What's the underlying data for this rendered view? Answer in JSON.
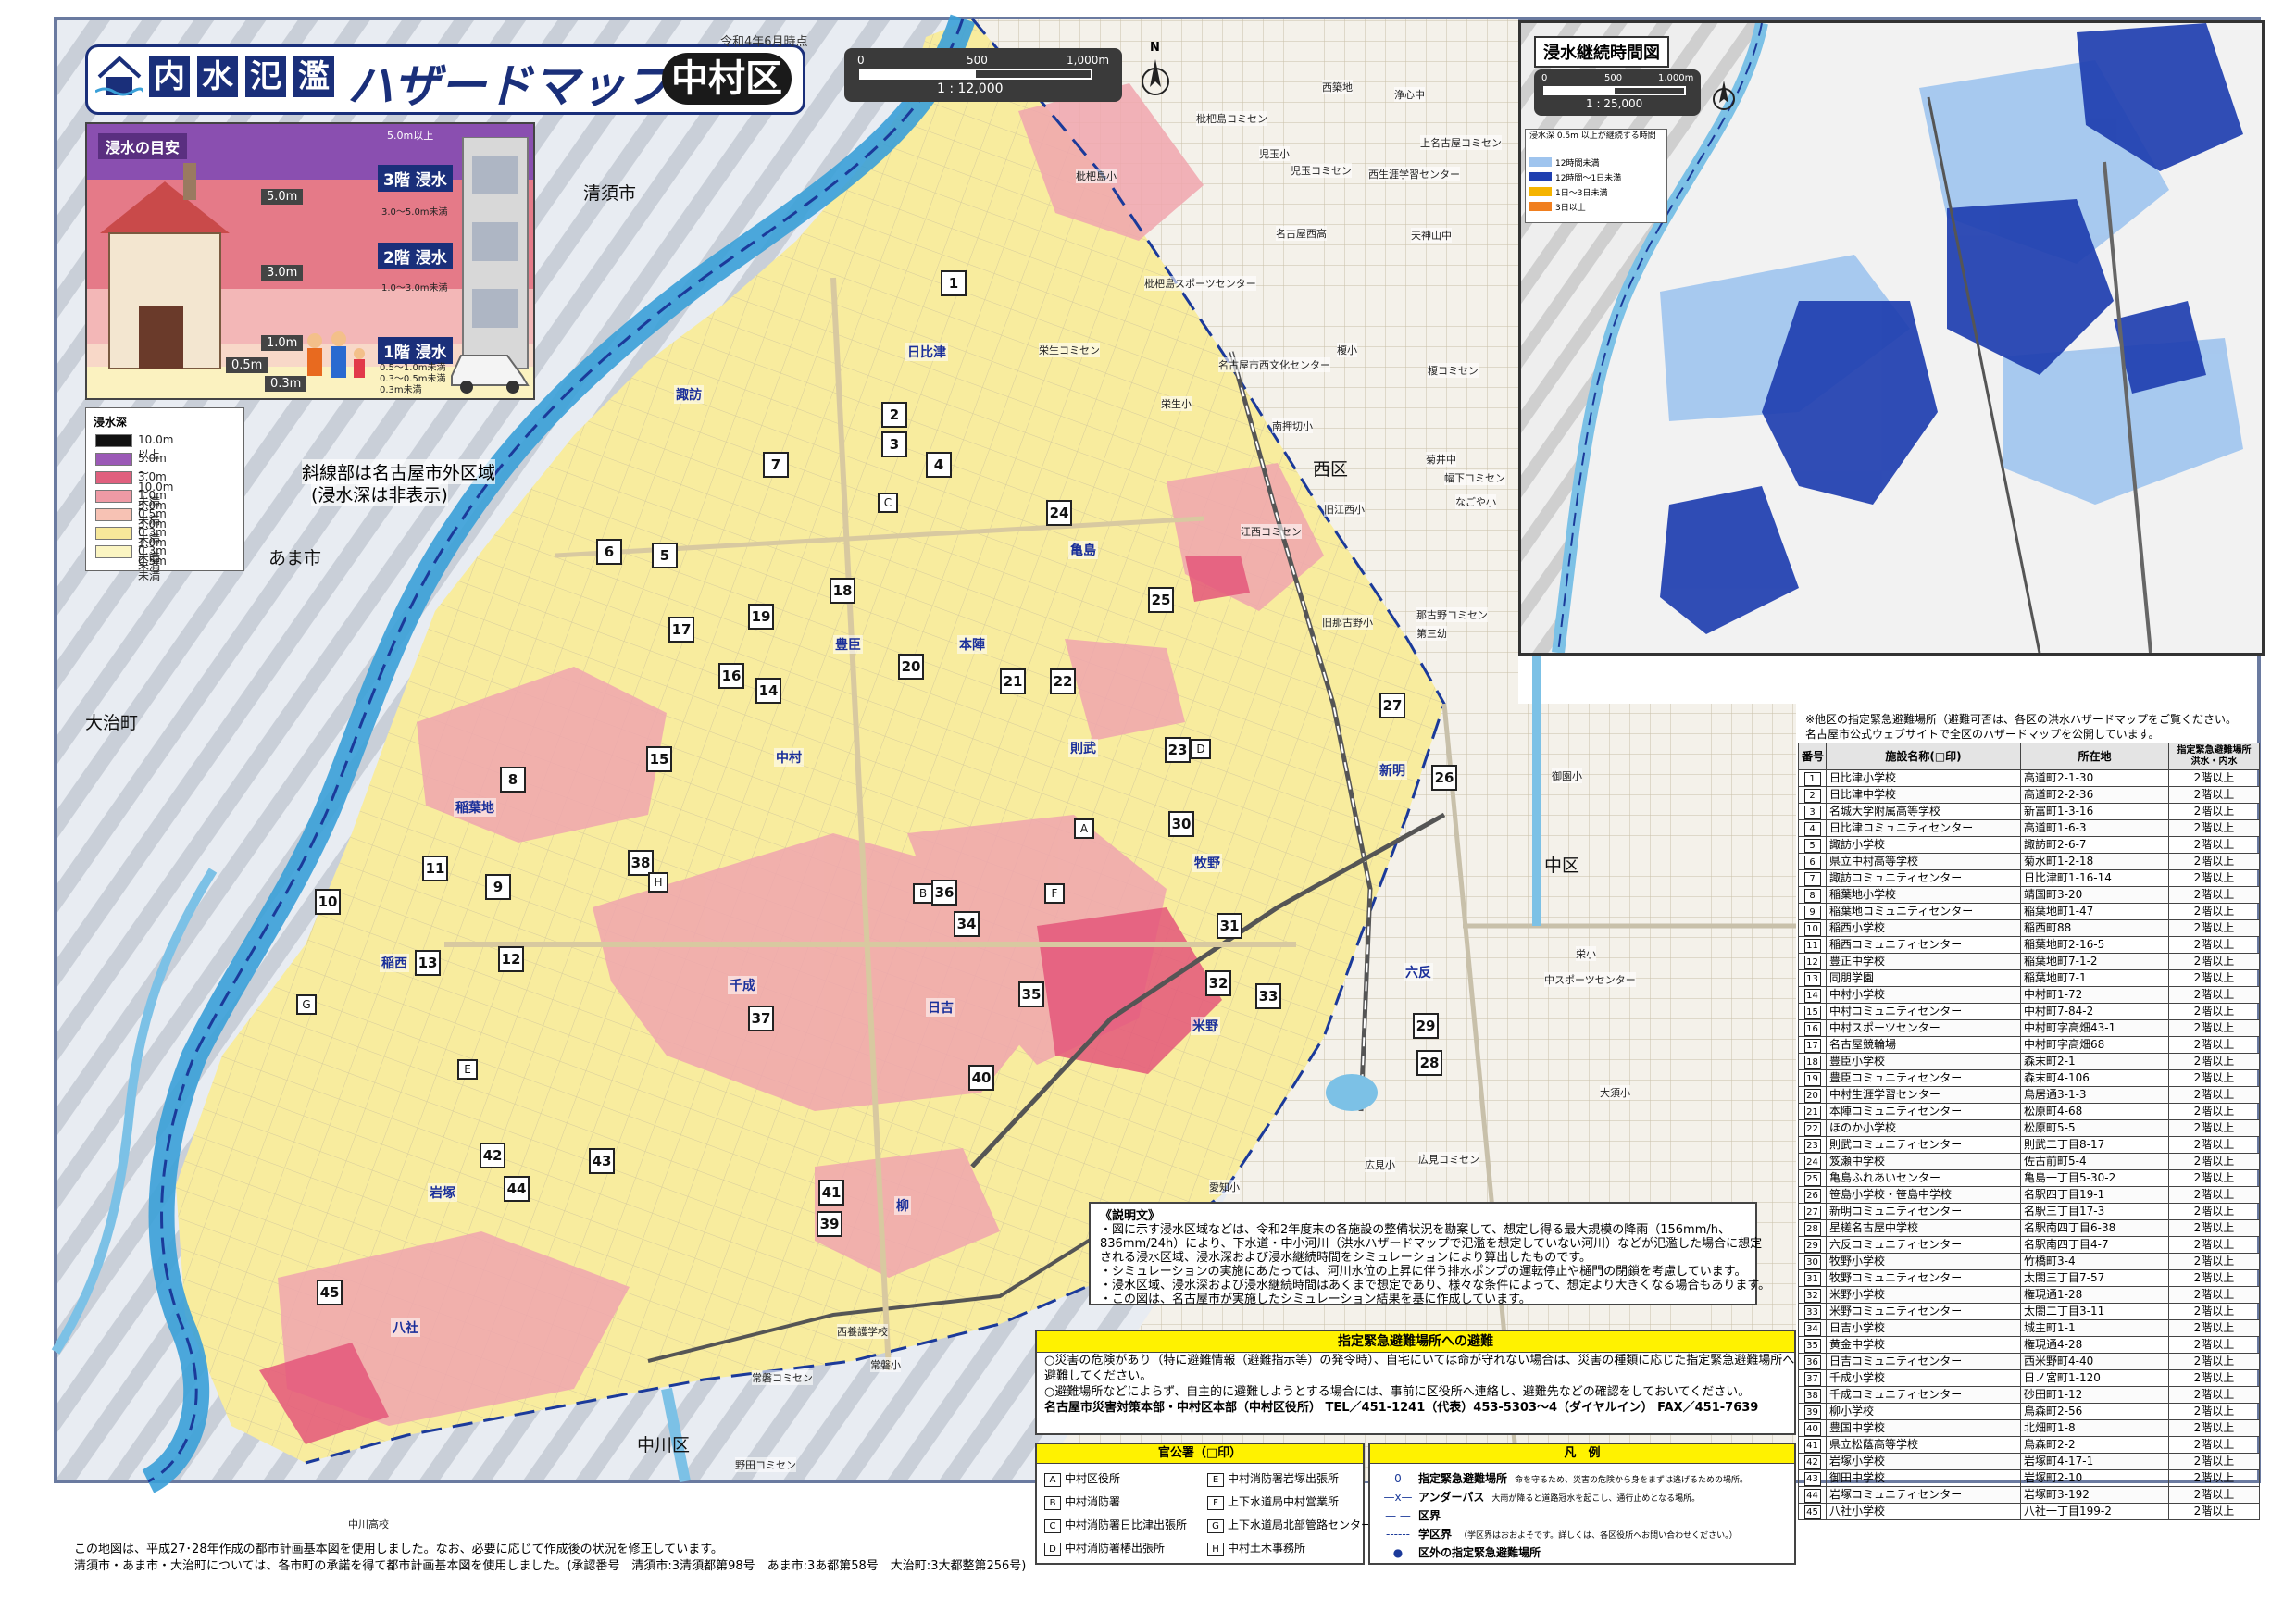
{
  "header": {
    "title_boxes": [
      "内",
      "水",
      "氾",
      "濫"
    ],
    "title_main": "ハザードマップ",
    "ward": "中村区",
    "date": "令和4年6月時点",
    "scale_ticks": [
      "0",
      "500",
      "1,000m"
    ],
    "scale_ratio": "1 : 12,000",
    "north": "N"
  },
  "depth_guide": {
    "title": "浸水の目安",
    "marks": [
      "5.0m",
      "3.0m",
      "1.0m",
      "0.5m",
      "0.3m"
    ],
    "top_label": "5.0m以上",
    "floors": [
      {
        "label": "3階 浸水",
        "range": "3.0～5.0m未満"
      },
      {
        "label": "2階 浸水",
        "range": "1.0～3.0m未満"
      },
      {
        "label": "1階 浸水",
        "range": "0.5～1.0m未満"
      }
    ],
    "low_ranges": [
      "0.3～0.5m未満",
      "0.3m未満"
    ]
  },
  "depth_legend": {
    "title": "浸水深",
    "items": [
      {
        "label": "10.0m以上",
        "color": "#111111"
      },
      {
        "label": "5.0m～10.0m未満",
        "color": "#9b59b6"
      },
      {
        "label": "3.0m～5.0m未満",
        "color": "#e0607e"
      },
      {
        "label": "1.0m～3.0m未満",
        "color": "#ef9aa5"
      },
      {
        "label": "0.5m～1.0m未満",
        "color": "#f7c2b4"
      },
      {
        "label": "0.3m～0.5m未満",
        "color": "#f7e89a"
      },
      {
        "label": "0.3m未満",
        "color": "#fbf5c2"
      }
    ]
  },
  "hatch_note": {
    "line1": "斜線部は名古屋市外区域",
    "line2": "(浸水深は非表示)"
  },
  "places": {
    "kiyosu": "清須市",
    "ama": "あま市",
    "oharu": "大治町",
    "nishi": "西区",
    "naka": "中区",
    "nakagawa": "中川区"
  },
  "districts": [
    "日比津",
    "諏訪",
    "亀島",
    "豊臣",
    "本陣",
    "中村",
    "則武",
    "新明",
    "稲葉地",
    "牧野",
    "稲西",
    "千成",
    "日吉",
    "米野",
    "六反",
    "岩塚",
    "柳",
    "八社"
  ],
  "facilities": [
    "枇杷島コミセン",
    "西築地",
    "浄心中",
    "児玉小",
    "児玉コミセン",
    "西生涯学習センター",
    "上名古屋コミセン",
    "枇杷島小",
    "名古屋西高",
    "天神山中",
    "枇杷島スポーツセンター",
    "栄生コミセン",
    "名古屋市西文化センター",
    "榎小",
    "榎コミセン",
    "栄生小",
    "南押切小",
    "菊井中",
    "幅下コミセン",
    "なごや小",
    "旧江西小",
    "江西コミセン",
    "那古野コミセン",
    "第三幼",
    "旧那古野小",
    "御園小",
    "栄小",
    "中スポーツセンター",
    "大須小",
    "愛知小",
    "広見小",
    "広見コミセン",
    "西養護学校",
    "常磐コミセン",
    "常磐小",
    "野田コミセン",
    "中川高校"
  ],
  "inset": {
    "title": "浸水継続時間図",
    "scale_ticks": [
      "0",
      "500",
      "1,000m"
    ],
    "scale_ratio": "1 : 25,000",
    "legend_title": "浸水深 0.5m 以上が継続する時間",
    "legend": [
      {
        "label": "12時間未満",
        "color": "#9fc4ee"
      },
      {
        "label": "12時間～1日未満",
        "color": "#1f3fb0"
      },
      {
        "label": "1日～3日未満",
        "color": "#f5b400"
      },
      {
        "label": "3日以上",
        "color": "#f07f1f"
      }
    ]
  },
  "shelter_note": {
    "line1": "※他区の指定緊急避難場所（避難可否は、各区の洪水ハザードマップをご覧ください。",
    "line2": "名古屋市公式ウェブサイトで全区のハザードマップを公開しています。"
  },
  "shelters": {
    "headers": [
      "番号",
      "施設名称(□印)",
      "所在地",
      "指定緊急避難場所 洪水・内水"
    ],
    "rows": [
      [
        "1",
        "日比津小学校",
        "高道町2-1-30",
        "2階以上"
      ],
      [
        "2",
        "日比津中学校",
        "高道町2-2-36",
        "2階以上"
      ],
      [
        "3",
        "名城大学附属高等学校",
        "新富町1-3-16",
        "2階以上"
      ],
      [
        "4",
        "日比津コミュニティセンター",
        "高道町1-6-3",
        "2階以上"
      ],
      [
        "5",
        "諏訪小学校",
        "諏訪町2-6-7",
        "2階以上"
      ],
      [
        "6",
        "県立中村高等学校",
        "菊水町1-2-18",
        "2階以上"
      ],
      [
        "7",
        "諏訪コミュニティセンター",
        "日比津町1-16-14",
        "2階以上"
      ],
      [
        "8",
        "稲葉地小学校",
        "靖国町3-20",
        "2階以上"
      ],
      [
        "9",
        "稲葉地コミュニティセンター",
        "稲葉地町1-47",
        "2階以上"
      ],
      [
        "10",
        "稲西小学校",
        "稲西町88",
        "2階以上"
      ],
      [
        "11",
        "稲西コミュニティセンター",
        "稲葉地町2-16-5",
        "2階以上"
      ],
      [
        "12",
        "豊正中学校",
        "稲葉地町7-1-2",
        "2階以上"
      ],
      [
        "13",
        "同朋学園",
        "稲葉地町7-1",
        "2階以上"
      ],
      [
        "14",
        "中村小学校",
        "中村町1-72",
        "2階以上"
      ],
      [
        "15",
        "中村コミュニティセンター",
        "中村町7-84-2",
        "2階以上"
      ],
      [
        "16",
        "中村スポーツセンター",
        "中村町字高畑43-1",
        "2階以上"
      ],
      [
        "17",
        "名古屋競輪場",
        "中村町字高畑68",
        "2階以上"
      ],
      [
        "18",
        "豊臣小学校",
        "森末町2-1",
        "2階以上"
      ],
      [
        "19",
        "豊臣コミュニティセンター",
        "森末町4-106",
        "2階以上"
      ],
      [
        "20",
        "中村生涯学習センター",
        "鳥居通3-1-3",
        "2階以上"
      ],
      [
        "21",
        "本陣コミュニティセンター",
        "松原町4-68",
        "2階以上"
      ],
      [
        "22",
        "ほのか小学校",
        "松原町5-5",
        "2階以上"
      ],
      [
        "23",
        "則武コミュニティセンター",
        "則武二丁目8-17",
        "2階以上"
      ],
      [
        "24",
        "笈瀬中学校",
        "佐古前町5-4",
        "2階以上"
      ],
      [
        "25",
        "亀島ふれあいセンター",
        "亀島一丁目5-30-2",
        "2階以上"
      ],
      [
        "26",
        "笹島小学校・笹島中学校",
        "名駅四丁目19-1",
        "2階以上"
      ],
      [
        "27",
        "新明コミュニティセンター",
        "名駅三丁目17-3",
        "2階以上"
      ],
      [
        "28",
        "星槎名古屋中学校",
        "名駅南四丁目6-38",
        "2階以上"
      ],
      [
        "29",
        "六反コミュニティセンター",
        "名駅南四丁目4-7",
        "2階以上"
      ],
      [
        "30",
        "牧野小学校",
        "竹橋町3-4",
        "2階以上"
      ],
      [
        "31",
        "牧野コミュニティセンター",
        "太閤三丁目7-57",
        "2階以上"
      ],
      [
        "32",
        "米野小学校",
        "権現通1-28",
        "2階以上"
      ],
      [
        "33",
        "米野コミュニティセンター",
        "太閤二丁目3-11",
        "2階以上"
      ],
      [
        "34",
        "日吉小学校",
        "城主町1-1",
        "2階以上"
      ],
      [
        "35",
        "黄金中学校",
        "権現通4-28",
        "2階以上"
      ],
      [
        "36",
        "日吉コミュニティセンター",
        "西米野町4-40",
        "2階以上"
      ],
      [
        "37",
        "千成小学校",
        "日ノ宮町1-120",
        "2階以上"
      ],
      [
        "38",
        "千成コミュニティセンター",
        "砂田町1-12",
        "2階以上"
      ],
      [
        "39",
        "柳小学校",
        "鳥森町2-56",
        "2階以上"
      ],
      [
        "40",
        "豊国中学校",
        "北畑町1-8",
        "2階以上"
      ],
      [
        "41",
        "県立松蔭高等学校",
        "鳥森町2-2",
        "2階以上"
      ],
      [
        "42",
        "岩塚小学校",
        "岩塚町4-17-1",
        "2階以上"
      ],
      [
        "43",
        "御田中学校",
        "岩塚町2-10",
        "2階以上"
      ],
      [
        "44",
        "岩塚コミュニティセンター",
        "岩塚町3-192",
        "2階以上"
      ],
      [
        "45",
        "八社小学校",
        "八社一丁目199-2",
        "2階以上"
      ]
    ]
  },
  "explanation": {
    "title": "《説明文》",
    "lines": [
      "・図に示す浸水区域などは、令和2年度末の各施設の整備状況を勘案して、想定し得る最大規模の降雨（156mm/h、",
      "  836mm/24h）により、下水道・中小河川（洪水ハザードマップで氾濫を想定していない河川）などが氾濫した場合に想定",
      "  される浸水区域、浸水深および浸水継続時間をシミュレーションにより算出したものです。",
      "・シミュレーションの実施にあたっては、河川水位の上昇に伴う排水ポンプの運転停止や樋門の閉鎖を考慮しています。",
      "・浸水区域、浸水深および浸水継続時間はあくまで想定であり、様々な条件によって、想定より大きくなる場合もあります。",
      "・この図は、名古屋市が実施したシミュレーション結果を基に作成しています。"
    ]
  },
  "evacuation": {
    "title": "指定緊急避難場所への避難",
    "lines": [
      "○災害の危険があり（特に避難情報（避難指示等）の発令時）、自宅にいては命が守れない場合は、災害の種類に応じた指定緊急避難場所へ",
      "  避難してください。",
      "○避難場所などによらず、自主的に避難しようとする場合には、事前に区役所へ連絡し、避難先などの確認をしておいてください。",
      "名古屋市災害対策本部・中村区本部（中村区役所）  TEL／451-1241（代表）453-5303～4（ダイヤルイン）  FAX／451-7639"
    ]
  },
  "offices": {
    "title": "官公署（□印）",
    "items": [
      [
        "A",
        "中村区役所"
      ],
      [
        "B",
        "中村消防署"
      ],
      [
        "C",
        "中村消防署日比津出張所"
      ],
      [
        "D",
        "中村消防署椿出張所"
      ],
      [
        "E",
        "中村消防署岩塚出張所"
      ],
      [
        "F",
        "上下水道局中村営業所"
      ],
      [
        "G",
        "上下水道局北部管路センター"
      ],
      [
        "H",
        "中村土木事務所"
      ]
    ]
  },
  "legend": {
    "title": "凡　例",
    "items": [
      [
        "0",
        "指定緊急避難場所",
        "命を守るため、災害の危険から身をまずは逃げるための場所。"
      ],
      [
        "—x—",
        "アンダーパス",
        "大雨が降ると道路冠水を起こし、通行止めとなる場所。"
      ],
      [
        "— —",
        "区界",
        ""
      ],
      [
        "------",
        "学区界",
        "（学区界はおおよそです。詳しくは、各区役所へお問い合わせください。）"
      ],
      [
        "●",
        "区外の指定緊急避難場所",
        ""
      ]
    ]
  },
  "footer": {
    "line1": "この地図は、平成27･28年作成の都市計画基本図を使用しました。なお、必要に応じて作成後の状況を修正しています。",
    "line2": "清須市・あま市・大治町については、各市町の承諾を得て都市計画基本図を使用しました。(承認番号　清須市:3清須都第98号　あま市:3あ都第58号　大治町:3大都整第256号)"
  },
  "shelter_markers": [
    "1",
    "2",
    "3",
    "4",
    "5",
    "6",
    "7",
    "8",
    "9",
    "10",
    "11",
    "12",
    "13",
    "14",
    "15",
    "16",
    "17",
    "18",
    "19",
    "20",
    "21",
    "22",
    "23",
    "24",
    "25",
    "26",
    "27",
    "28",
    "29",
    "30",
    "31",
    "32",
    "33",
    "34",
    "35",
    "36",
    "37",
    "38",
    "39",
    "40",
    "41",
    "42",
    "43",
    "44",
    "45"
  ],
  "office_markers": [
    "A",
    "B",
    "C",
    "D",
    "E",
    "F",
    "G",
    "H"
  ]
}
